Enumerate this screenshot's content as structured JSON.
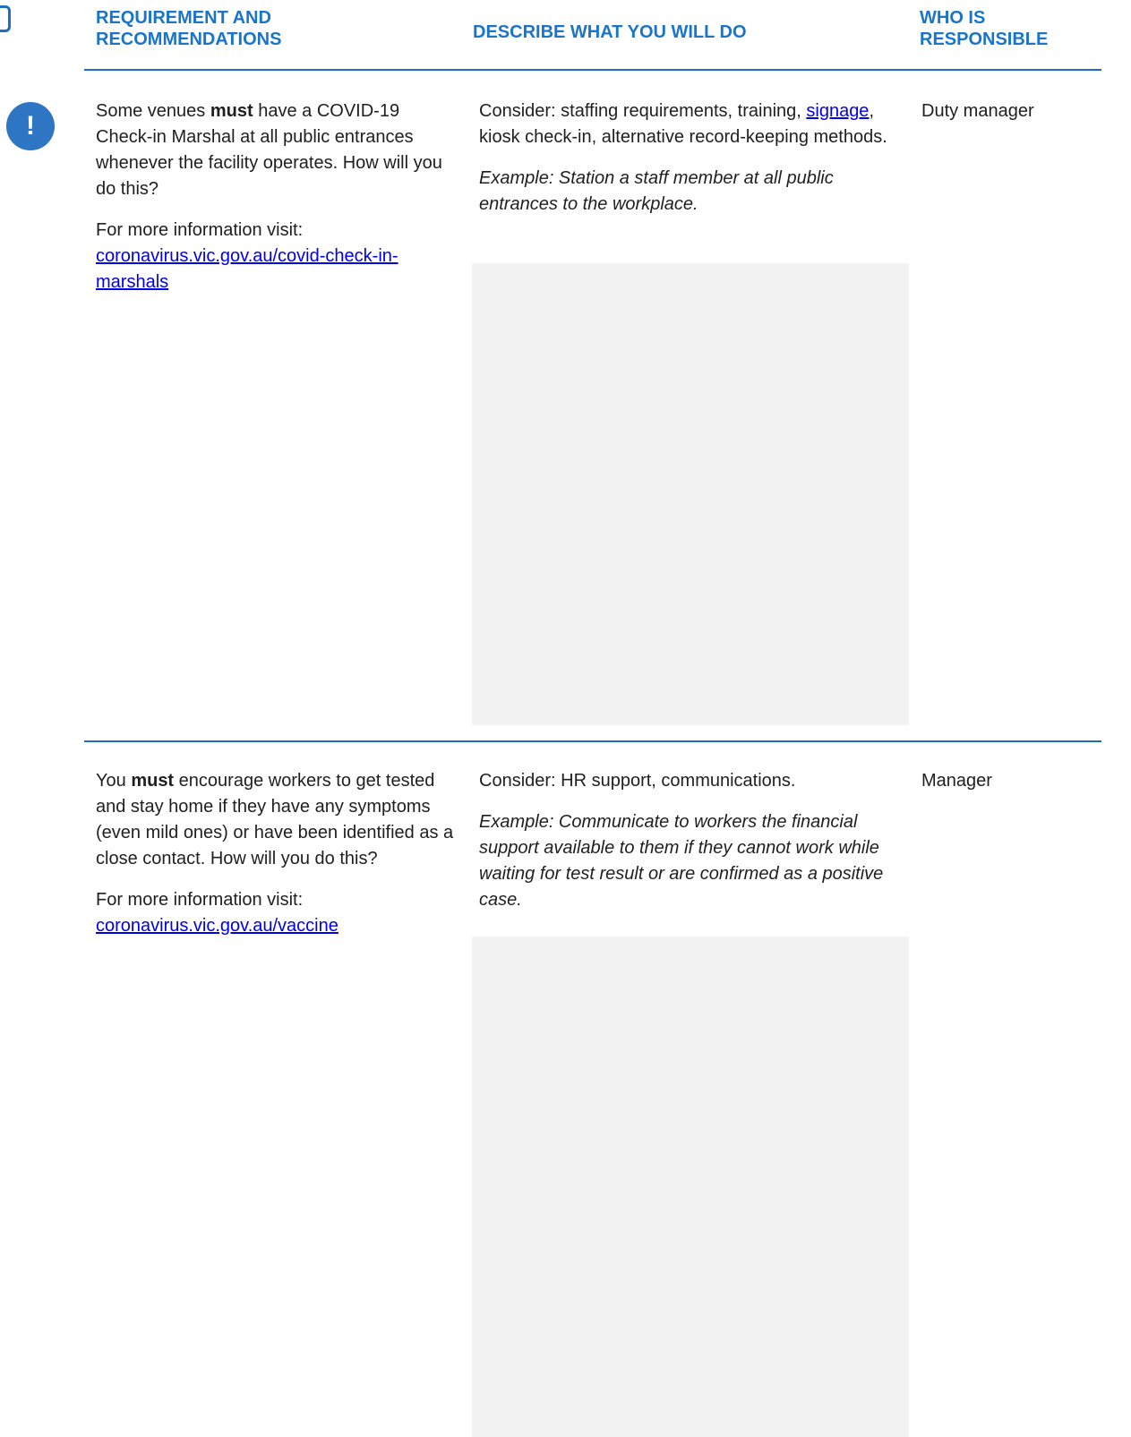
{
  "header": {
    "col1": "REQUIREMENT AND\nRECOMMENDATIONS",
    "col2": "DESCRIBE WHAT YOU WILL DO",
    "col3": "WHO IS\nRESPONSIBLE"
  },
  "rows": [
    {
      "req_pre": "Some venues ",
      "req_bold": "must",
      "req_post": " have a COVID-19 Check-in Marshal at all public entrances whenever the facility operates. How will you do this?",
      "info_label": "For more information visit:",
      "info_link": "coronavirus.vic.gov.au/covid-check-in-marshals",
      "consider_pre": "Consider: staffing requirements, training, ",
      "consider_link": "signage",
      "consider_post": ", kiosk check-in, alternative record-keeping methods.",
      "example": "Example: Station a staff member at all public entrances to the workplace.",
      "who": "Duty manager",
      "alert_symbol": "!"
    },
    {
      "req_pre": "You ",
      "req_bold": "must",
      "req_post": " encourage workers to get tested and stay home if they have any symptoms (even mild ones) or have been identified as a close contact. How will you do this?",
      "info_label": "For more information visit:",
      "info_link": "coronavirus.vic.gov.au/vaccine",
      "consider": "Consider: HR support, communications.",
      "example": "Example: Communicate to workers the financial support available to them if they cannot work while waiting for test result or are confirmed as a positive case.",
      "who": "Manager"
    }
  ],
  "colors": {
    "accent": "#1a75c8",
    "rule": "#1f6fc0",
    "box": "#f2f2f2",
    "link": "#0000ee"
  }
}
